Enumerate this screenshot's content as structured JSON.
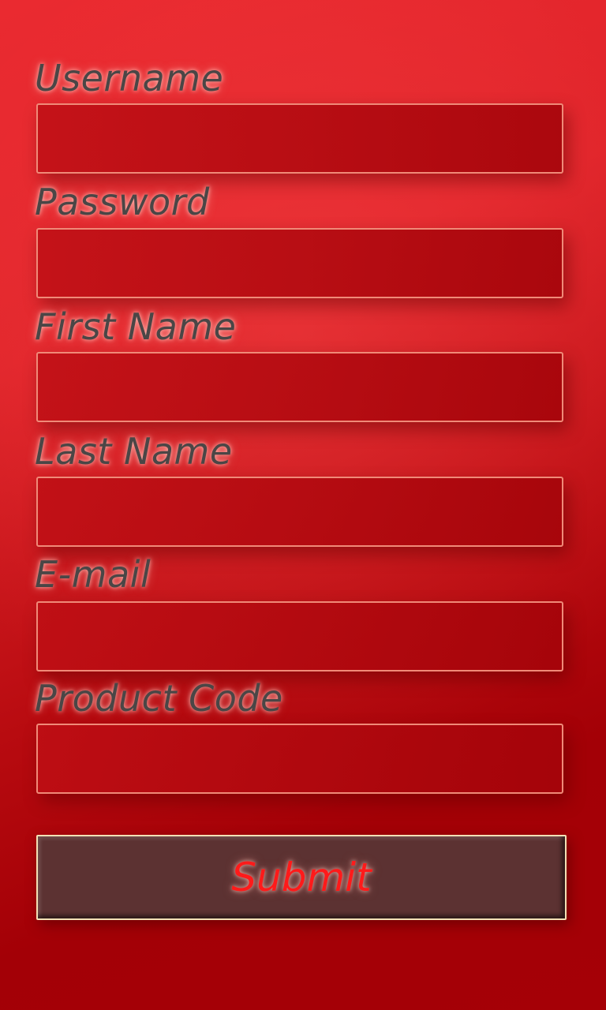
{
  "form": {
    "fields": [
      {
        "label": "Username",
        "value": ""
      },
      {
        "label": "Password",
        "value": ""
      },
      {
        "label": "First Name",
        "value": ""
      },
      {
        "label": "Last Name",
        "value": ""
      },
      {
        "label": "E-mail",
        "value": ""
      },
      {
        "label": "Product Code",
        "value": ""
      }
    ],
    "submit_label": "Submit"
  },
  "colors": {
    "background_light": "#ea2a30",
    "background_dark": "#a30006",
    "input_border": "#f08a78",
    "label_text": "#4a4646",
    "button_bg": "#5c3232",
    "button_text": "#ff1a1a"
  }
}
